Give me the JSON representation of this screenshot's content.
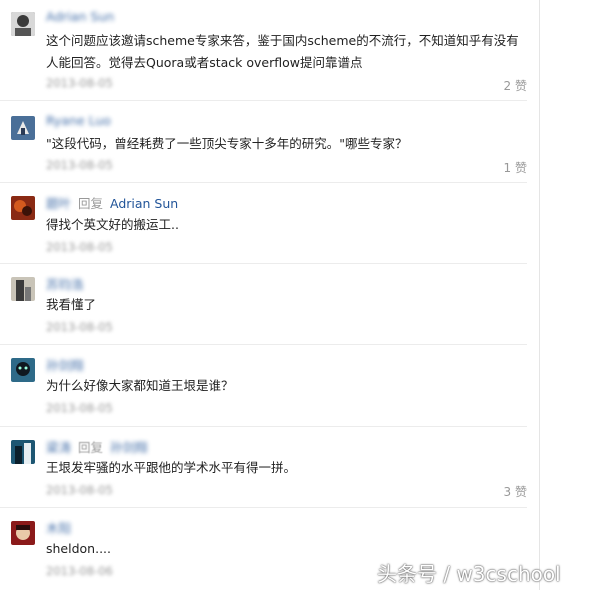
{
  "comments": [
    {
      "author": "Adrian Sun",
      "reply_prefix": "",
      "reply_to": "",
      "text": "这个问题应该邀请scheme专家来答，鉴于国内scheme的不流行，不知道知乎有没有人能回答。觉得去Quora或者stack overflow提问靠谱点",
      "time": "2013-08-05",
      "likes": "2 赞",
      "avatar_color": "#6c6a6a"
    },
    {
      "author": "Ryane Luo",
      "reply_prefix": "",
      "reply_to": "",
      "text": "\"这段代码，曾经耗费了一些顶尖专家十多年的研究。\"哪些专家？",
      "time": "2013-08-05",
      "likes": "1 赞",
      "avatar_color": "#4a6f98"
    },
    {
      "author": "题叶",
      "reply_prefix": "回复",
      "reply_to": "Adrian Sun",
      "text": "得找个英文好的搬运工..",
      "time": "2013-08-05",
      "likes": "",
      "avatar_color": "#8a2a14"
    },
    {
      "author": "苏钧浩",
      "reply_prefix": "",
      "reply_to": "",
      "text": "我看懂了",
      "time": "2013-08-05",
      "likes": "",
      "avatar_color": "#3b3b3b"
    },
    {
      "author": "孙剑翔",
      "reply_prefix": "",
      "reply_to": "",
      "text": "为什么好像大家都知道王垠是谁？",
      "time": "2013-08-05",
      "likes": "",
      "avatar_color": "#2e6a88"
    },
    {
      "author": "梁涛",
      "reply_prefix": "回复",
      "reply_to": "孙剑翔",
      "text": "王垠发牢骚的水平跟他的学术水平有得一拼。",
      "time": "2013-08-05",
      "likes": "3 赞",
      "avatar_color": "#1d5672"
    },
    {
      "author": "木阳",
      "reply_prefix": "",
      "reply_to": "",
      "text": "sheldon....",
      "time": "2013-08-06",
      "likes": "",
      "avatar_color": "#8b1a1a"
    }
  ],
  "watermark": "头条号 / w3cschool"
}
